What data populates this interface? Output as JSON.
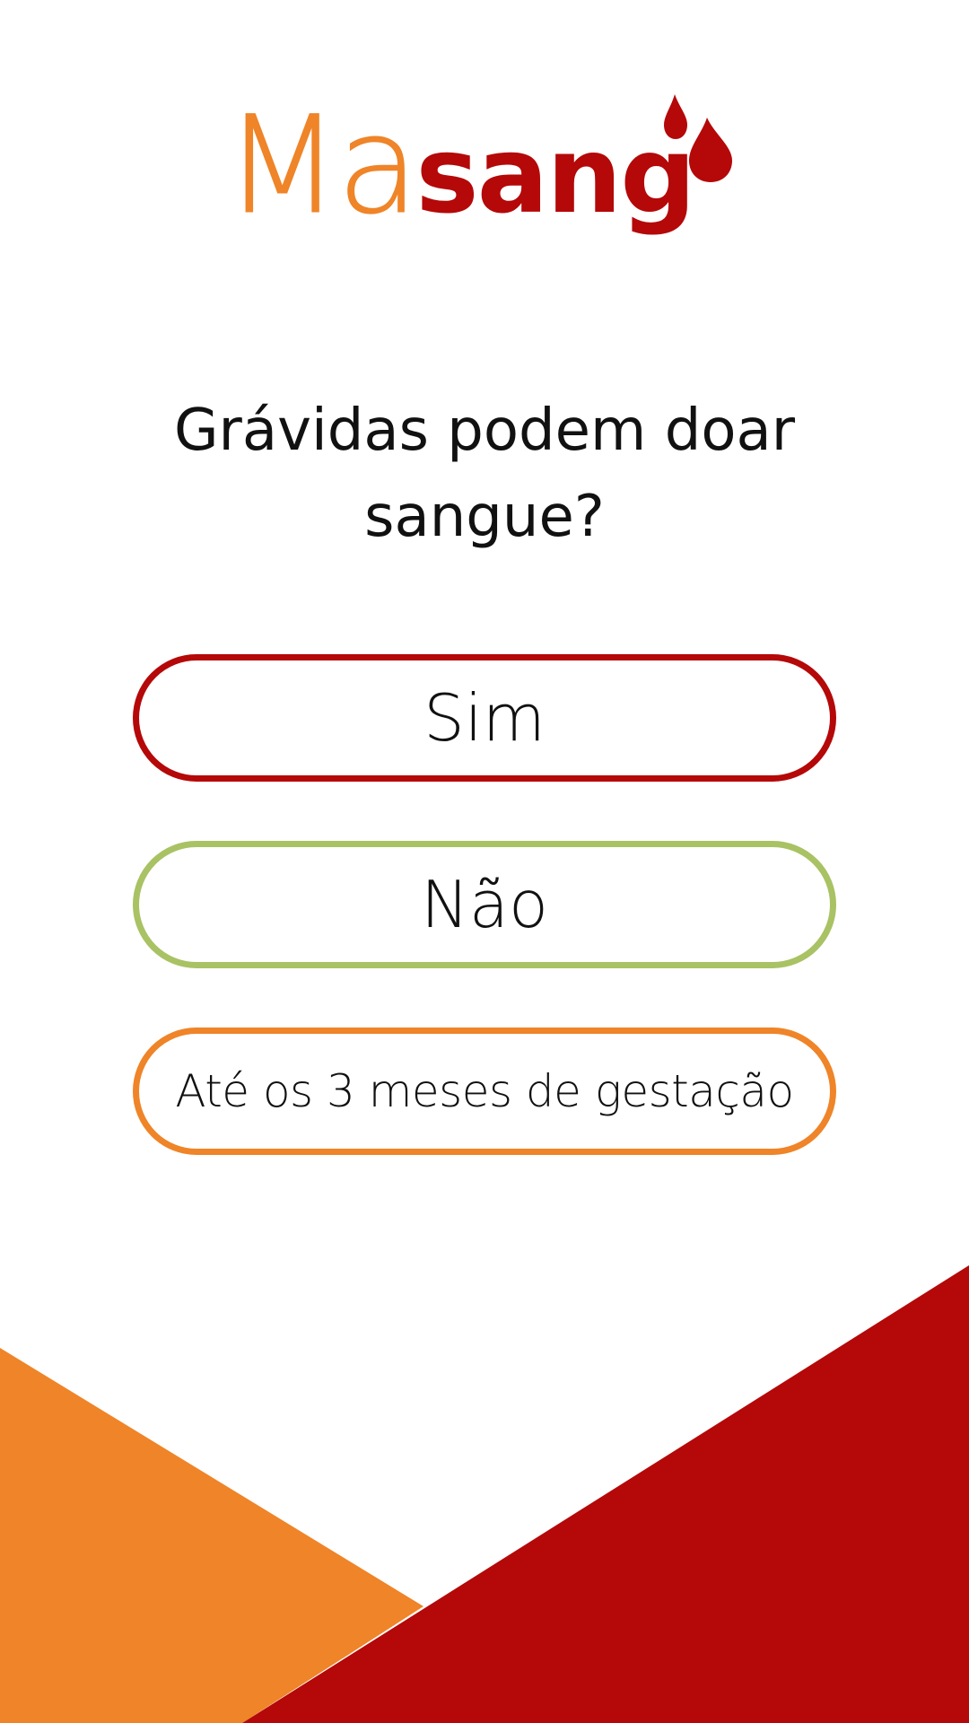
{
  "app": {
    "logo": {
      "part1": "Ma",
      "part2": "sang"
    }
  },
  "question": {
    "text": "Grávidas podem doar sangue?"
  },
  "answers": [
    {
      "label": "Sim",
      "color": "#b50808"
    },
    {
      "label": "Não",
      "color": "#a9c264"
    },
    {
      "label": "Até os 3 meses de gestação",
      "color": "#ef8428"
    }
  ],
  "colors": {
    "brand_orange": "#ef8428",
    "brand_red": "#b50808",
    "brand_green": "#a9c264"
  }
}
